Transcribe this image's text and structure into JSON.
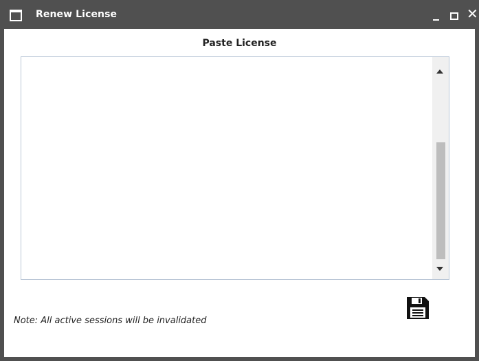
{
  "window": {
    "title": "Renew License",
    "icon": "window-icon",
    "controls": {
      "minimize": "minimize-icon",
      "maximize": "maximize-icon",
      "close": "close-icon"
    }
  },
  "main": {
    "heading": "Paste License",
    "license_text": "",
    "save_icon": "floppy-disk-icon",
    "note": "Note: All active sessions will be invalidated"
  },
  "colors": {
    "titlebar": "#505050",
    "border": "#505050",
    "scroll_thumb": "#bdbdbd",
    "textarea_border": "#b9c6d6"
  }
}
